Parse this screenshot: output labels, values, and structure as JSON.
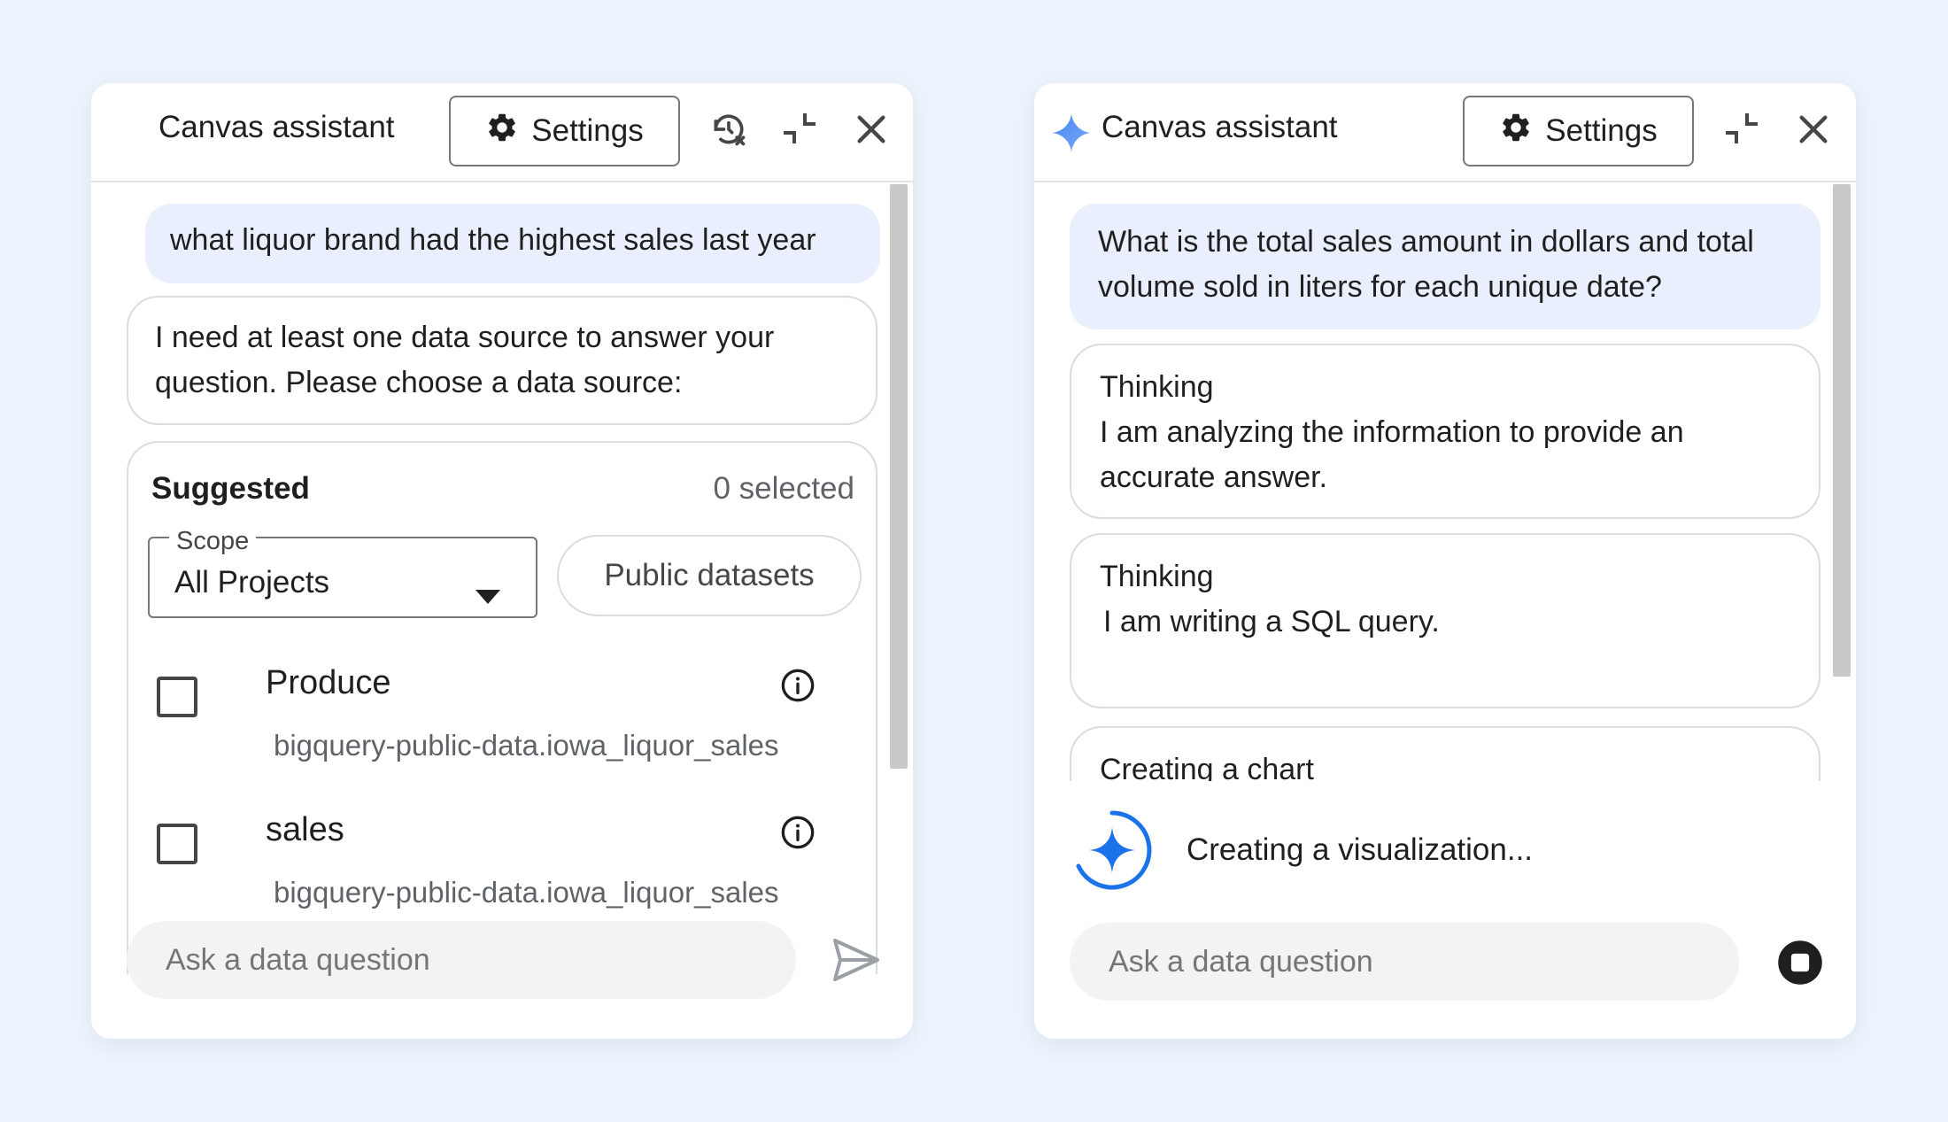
{
  "left": {
    "title": "Canvas assistant",
    "settings_label": "Settings",
    "user_message": "what liquor brand had the highest sales last year",
    "ai_message_line1": "I need at least one data source to answer your",
    "ai_message_line2": "question. Please choose a data source:",
    "suggested_label": "Suggested",
    "selected_count": "0 selected",
    "scope_label": "Scope",
    "scope_value": "All Projects",
    "public_datasets_label": "Public datasets",
    "sources": [
      {
        "name": "Produce",
        "path": "bigquery-public-data.iowa_liquor_sales"
      },
      {
        "name": "sales",
        "path": "bigquery-public-data.iowa_liquor_sales"
      }
    ],
    "input_placeholder": "Ask a data question"
  },
  "right": {
    "title": "Canvas assistant",
    "settings_label": "Settings",
    "user_message_line1": "What is the total sales amount in dollars and total",
    "user_message_line2": "volume sold in liters for each unique date?",
    "steps": [
      {
        "title": "Thinking",
        "line1": "I am analyzing the information to provide an",
        "line2": "accurate answer."
      },
      {
        "title": "Thinking",
        "line1": "I am writing a SQL query.",
        "line2": ""
      },
      {
        "title": "Creating a chart",
        "line1": "",
        "line2": ""
      }
    ],
    "status_text": "Creating a visualization...",
    "input_placeholder": "Ask a data question"
  },
  "colors": {
    "background": "#eef4fd",
    "user_bubble": "#e9effd",
    "accent_blue": "#1a73e8",
    "text": "#1f1f1f",
    "secondary_text": "#5f6368"
  }
}
